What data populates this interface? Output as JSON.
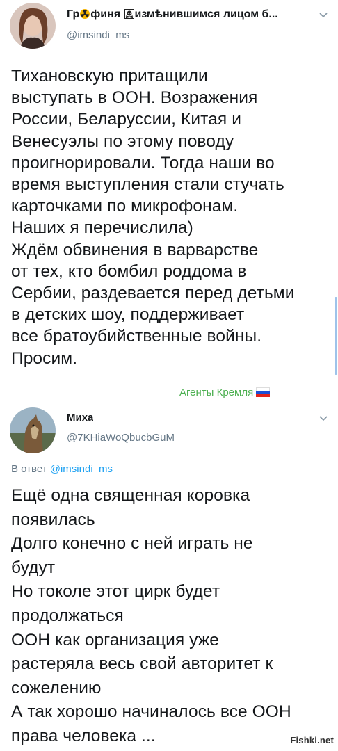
{
  "tweet1": {
    "name_prefix": "Гр",
    "name_middle": "финя",
    "name_suffix": "измѣнившимся лицом б...",
    "handle": "@imsindi_ms",
    "text": "Тихановскую притащили\nвыступать в ООН. Возражения\nРоссии, Беларуссии, Китая и\nВенесуэлы по этому поводу\nпроигнорировали. Тогда наши во\nвремя выступления стали стучать\nкарточками по микрофонам.\nНаших я перечислила)\nЖдём обвинения в варварстве\nот тех, кто бомбил роддома в\nСербии, раздевается перед детьми\nв детских шоу, поддерживает\nвсе братоубийственные войны.\nПросим.",
    "sticker": "Агенты Кремля"
  },
  "tweet2": {
    "name": "Миха",
    "handle": "@7KHiaWoQbucbGuM",
    "reply_prefix": "В ответ",
    "reply_mention": "@imsindi_ms",
    "text": "Ещё одна священная коровка\nпоявилась\nДолго конечно с ней играть не\nбудут\nНо токоле этот цирк будет\nпродолжаться\nООН как организация уже\nрастеряла весь свой авторитет к\nсожелению\nА так хорошо начиналось все ООН\nправа человека ..."
  },
  "watermark": "Fishki.net",
  "icons": {
    "name_icon_1": "radioactive-icon",
    "name_icon_2": "skull-crossbones-icon",
    "flag_icon": "russian-flag-icon",
    "chevron": "chevron-down-icon"
  },
  "colors": {
    "accent": "#1da1f2",
    "secondary_text": "#657786",
    "sticker": "#4caf50"
  }
}
